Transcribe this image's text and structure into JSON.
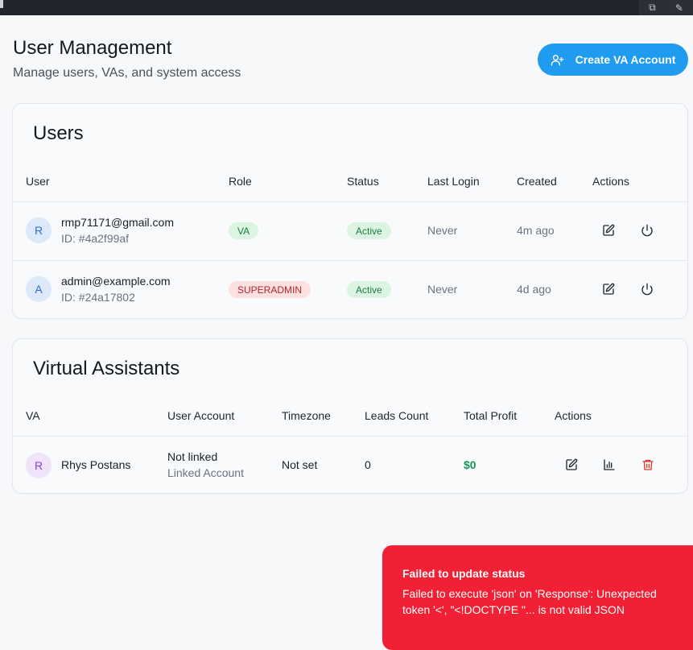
{
  "header": {
    "title": "User Management",
    "subtitle": "Manage users, VAs, and system access",
    "create_button_label": "Create VA Account"
  },
  "users_card": {
    "title": "Users",
    "columns": [
      "User",
      "Role",
      "Status",
      "Last Login",
      "Created",
      "Actions"
    ],
    "rows": [
      {
        "initial": "R",
        "email": "rmp71171@gmail.com",
        "id": "ID: #4a2f99af",
        "role": "VA",
        "status": "Active",
        "last_login": "Never",
        "created": "4m ago"
      },
      {
        "initial": "A",
        "email": "admin@example.com",
        "id": "ID: #24a17802",
        "role": "SUPERADMIN",
        "status": "Active",
        "last_login": "Never",
        "created": "4d ago"
      }
    ]
  },
  "va_card": {
    "title": "Virtual Assistants",
    "columns": [
      "VA",
      "User Account",
      "Timezone",
      "Leads Count",
      "Total Profit",
      "Actions"
    ],
    "rows": [
      {
        "initial": "R",
        "name": "Rhys Postans",
        "account": "Not linked",
        "account_sub": "Linked Account",
        "timezone": "Not set",
        "leads": "0",
        "profit": "$0"
      }
    ]
  },
  "toast": {
    "title": "Failed to update status",
    "message": "Failed to execute 'json' on 'Response': Unexpected token '<', \"<!DOCTYPE \"... is not valid JSON"
  },
  "colors": {
    "accent": "#1f9cf0",
    "error": "#f22035",
    "success": "#16945a"
  }
}
